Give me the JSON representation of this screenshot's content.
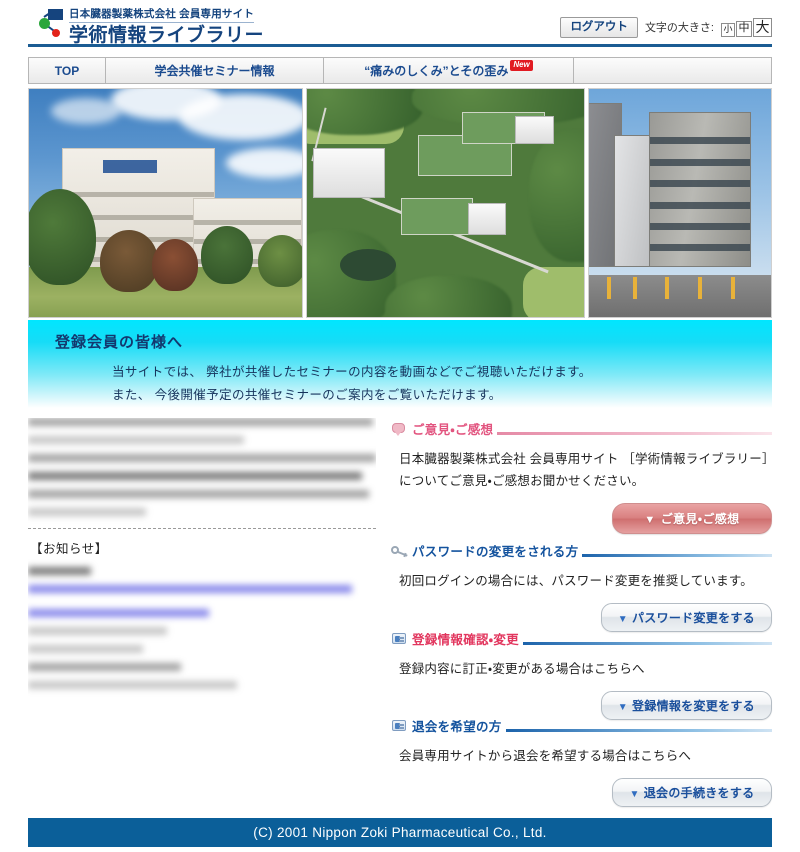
{
  "header": {
    "logo_sub": "日本臓器製薬株式会社 会員専用サイト",
    "logo_main": "学術情報ライブラリー",
    "logout_label": "ログアウト",
    "fontsize_label": "文字の大きさ:",
    "fontsize_small": "小",
    "fontsize_medium": "中",
    "fontsize_large": "大"
  },
  "nav": {
    "tabs": [
      {
        "label": "TOP",
        "badge": ""
      },
      {
        "label": "学会共催セミナー情報",
        "badge": ""
      },
      {
        "label": "“痛みのしくみ”とその歪み",
        "badge": "New"
      }
    ]
  },
  "hero": {
    "images": [
      {
        "alt": "日本臓器製薬 本社ビル外観"
      },
      {
        "alt": "工場・研究所 航空写真"
      },
      {
        "alt": "都市部オフィスビル外観"
      }
    ]
  },
  "banner": {
    "title": "登録会員の皆様へ",
    "line1": "当サイトでは、 弊社が共催したセミナーの内容を動画などでご視聴いただけます。",
    "line2": "また、 今後開催予定の共催セミナーのご案内をご覧いただけます。"
  },
  "left_column": {
    "notice_heading": "【お知らせ】"
  },
  "sections": [
    {
      "id": "feedback",
      "icon": "speech-bubble-icon",
      "theme": "pink",
      "title": "ご意見・ご感想",
      "body_line1": "日本臓器製薬株式会社 会員専用サイト ［学術情報ライブラリー］",
      "body_line2": "についてご意見・ご感想お聞かせください。",
      "button_label": "ご意見・ご感想",
      "button_triangle": "▼"
    },
    {
      "id": "password",
      "icon": "key-icon",
      "theme": "blue",
      "title": "パスワードの変更をされる方",
      "body_line1": "初回ログインの場合には、パスワード変更を推奨しています。",
      "body_line2": "",
      "button_label": "パスワード変更をする",
      "button_triangle": "▼"
    },
    {
      "id": "registration",
      "icon": "id-card-icon",
      "theme": "red",
      "title": "登録情報確認・変更",
      "body_line1": "登録内容に訂正・変更がある場合はこちらへ",
      "body_line2": "",
      "button_label": "登録情報を変更をする",
      "button_triangle": "▼"
    },
    {
      "id": "withdrawal",
      "icon": "id-card-icon",
      "theme": "blue",
      "title": "退会を希望の方",
      "body_line1": "会員専用サイトから退会を希望する場合はこちらへ",
      "body_line2": "",
      "button_label": "退会の手続きをする",
      "button_triangle": "▼"
    }
  ],
  "footer": {
    "copyright": "(C) 2001 Nippon Zoki Pharmaceutical Co., Ltd."
  },
  "colors": {
    "brand_blue": "#15447e",
    "rule_blue": "#1b5c93",
    "footer_blue": "#0b5f99",
    "accent_pink": "#e2547f",
    "accent_red": "#e2365e",
    "banner_cyan": "#00e6ff",
    "new_badge_red": "#e11b22"
  }
}
